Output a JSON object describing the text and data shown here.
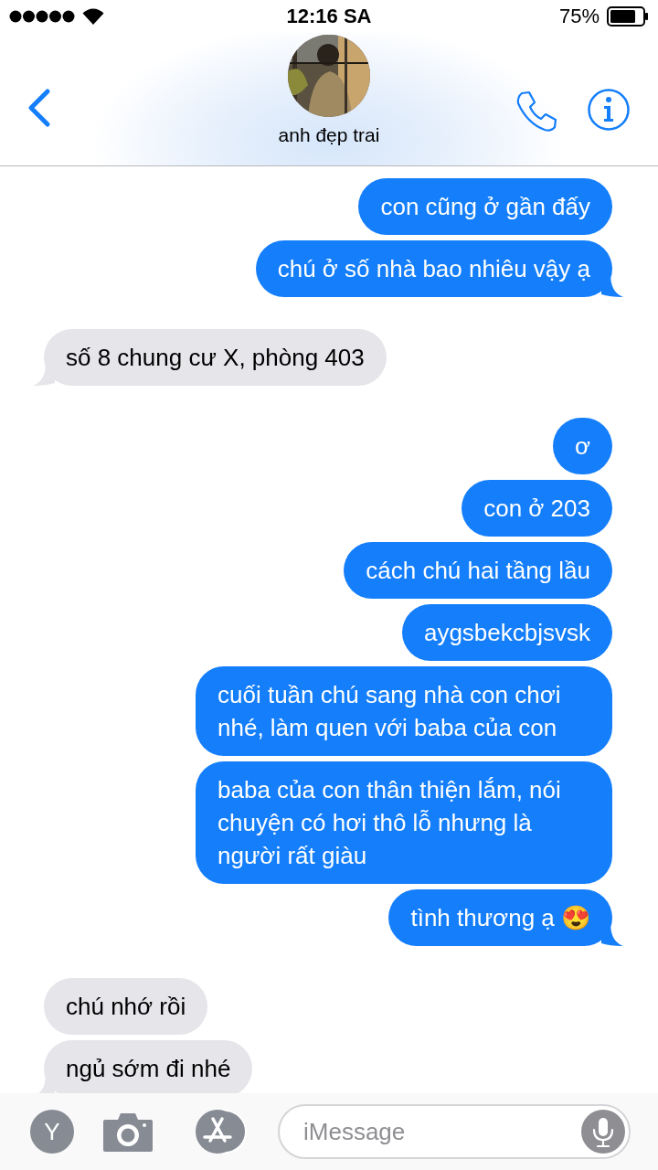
{
  "status_bar": {
    "time": "12:16 SA",
    "battery_percent": "75%"
  },
  "contact": {
    "name": "anh đẹp trai"
  },
  "messages": [
    {
      "outgoing": true,
      "text": "con cũng ở gần đấy"
    },
    {
      "outgoing": true,
      "text": "chú ở số nhà bao nhiêu vậy ạ"
    },
    {
      "outgoing": false,
      "text": "số 8 chung cư X, phòng 403"
    },
    {
      "outgoing": true,
      "text": "ơ"
    },
    {
      "outgoing": true,
      "text": "con ở 203"
    },
    {
      "outgoing": true,
      "text": "cách chú hai tầng lầu"
    },
    {
      "outgoing": true,
      "text": "aygsbekcbjsvsk"
    },
    {
      "outgoing": true,
      "text": "cuối tuần chú sang nhà con chơi nhé, làm quen với baba của con"
    },
    {
      "outgoing": true,
      "text": "baba của con thân thiện lắm, nói chuyện có hơi thô lỗ nhưng là người rất giàu"
    },
    {
      "outgoing": true,
      "text": "tình thương ạ 😍"
    },
    {
      "outgoing": false,
      "text": "chú nhớ rồi"
    },
    {
      "outgoing": false,
      "text": "ngủ sớm đi nhé"
    }
  ],
  "compose": {
    "app_letter": "Y",
    "placeholder": "iMessage"
  }
}
